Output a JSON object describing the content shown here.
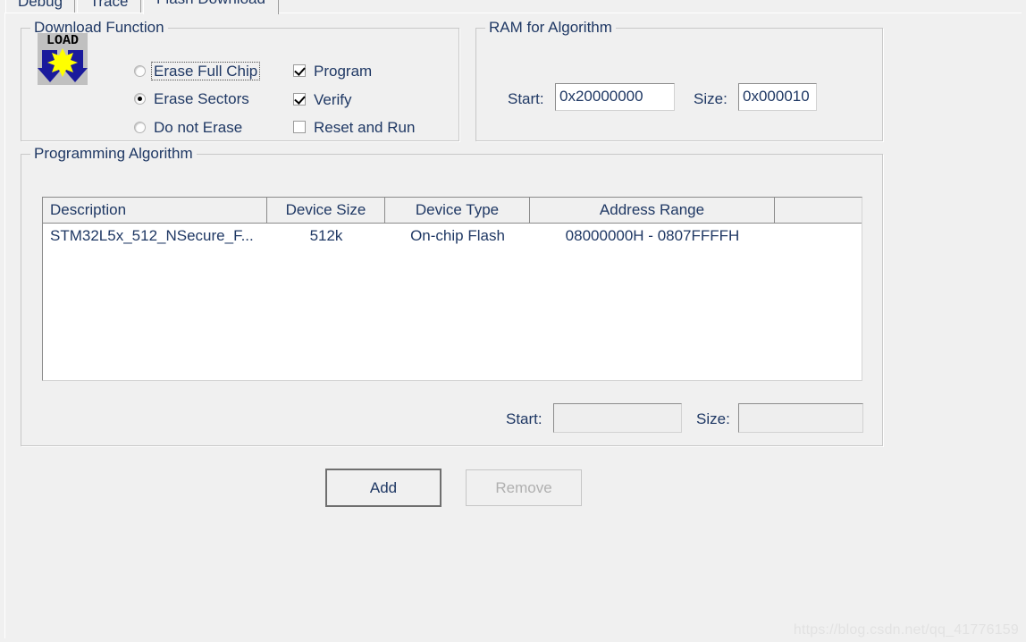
{
  "tabs": [
    {
      "label": "Debug",
      "active": false
    },
    {
      "label": "Trace",
      "active": false
    },
    {
      "label": "Flash Download",
      "active": true
    }
  ],
  "download_function": {
    "title": "Download Function",
    "icon_text": "LOAD",
    "erase_options": [
      {
        "label": "Erase Full Chip",
        "selected": false,
        "focused": true
      },
      {
        "label": "Erase Sectors",
        "selected": true,
        "focused": false
      },
      {
        "label": "Do not Erase",
        "selected": false,
        "focused": false
      }
    ],
    "checkboxes": [
      {
        "label": "Program",
        "checked": true
      },
      {
        "label": "Verify",
        "checked": true
      },
      {
        "label": "Reset and Run",
        "checked": false
      }
    ]
  },
  "ram_for_algorithm": {
    "title": "RAM for Algorithm",
    "start_label": "Start:",
    "start_value": "0x20000000",
    "size_label": "Size:",
    "size_value": "0x000010"
  },
  "programming_algorithm": {
    "title": "Programming Algorithm",
    "columns": [
      "Description",
      "Device Size",
      "Device Type",
      "Address Range",
      ""
    ],
    "rows": [
      {
        "description": "STM32L5x_512_NSecure_F...",
        "device_size": "512k",
        "device_type": "On-chip Flash",
        "address_range": "08000000H - 0807FFFFH",
        "extra": ""
      }
    ],
    "range_start_label": "Start:",
    "range_start_value": "",
    "range_size_label": "Size:",
    "range_size_value": ""
  },
  "buttons": {
    "add": "Add",
    "remove": "Remove"
  },
  "watermark": "https://blog.csdn.net/qq_41776159",
  "colors": {
    "dialog_bg": "#f0f0f0",
    "text": "#1f3864",
    "field_bg": "#ffffff",
    "disabled_text": "#b0b0b0",
    "icon_blue": "#1a1a9c",
    "icon_yellow": "#ffff00"
  }
}
